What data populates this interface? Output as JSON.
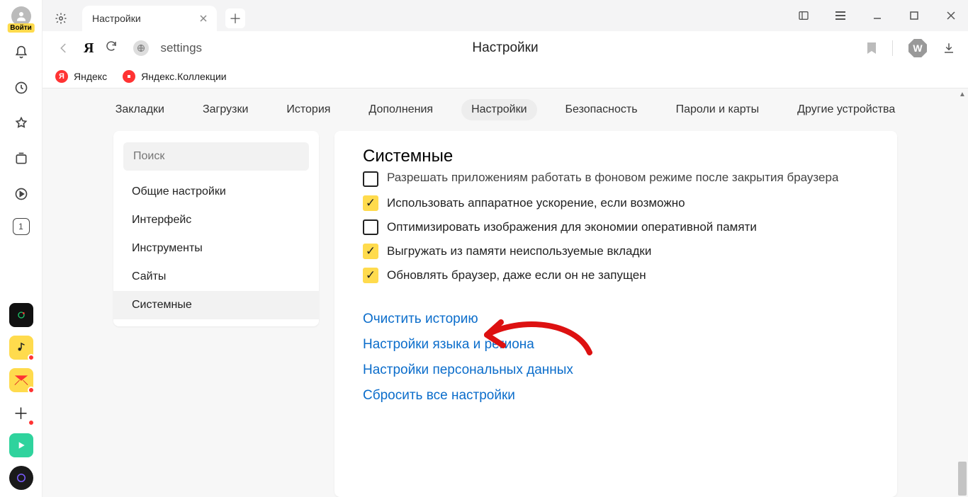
{
  "sidebar": {
    "login_label": "Войти",
    "badge_square": "1"
  },
  "tabstrip": {
    "tab_label": "Настройки"
  },
  "addr": {
    "url_text": "settings",
    "center_title": "Настройки",
    "w_badge": "W"
  },
  "bookmarks_bar": {
    "item1": "Яндекс",
    "item2": "Яндекс.Коллекции"
  },
  "topnav": {
    "i0": "Закладки",
    "i1": "Загрузки",
    "i2": "История",
    "i3": "Дополнения",
    "i4": "Настройки",
    "i5": "Безопасность",
    "i6": "Пароли и карты",
    "i7": "Другие устройства"
  },
  "leftpanel": {
    "search_placeholder": "Поиск",
    "i0": "Общие настройки",
    "i1": "Интерфейс",
    "i2": "Инструменты",
    "i3": "Сайты",
    "i4": "Системные"
  },
  "rightpanel": {
    "heading": "Системные",
    "opt_cut": "Разрешать приложениям работать в фоновом режиме после закрытия браузера",
    "opt1": "Использовать аппаратное ускорение, если возможно",
    "opt2": "Оптимизировать изображения для экономии оперативной памяти",
    "opt3": "Выгружать из памяти неиспользуемые вкладки",
    "opt4": "Обновлять браузер, даже если он не запущен",
    "link1": "Очистить историю",
    "link2": "Настройки языка и региона",
    "link3": "Настройки персональных данных",
    "link4": "Сбросить все настройки"
  }
}
